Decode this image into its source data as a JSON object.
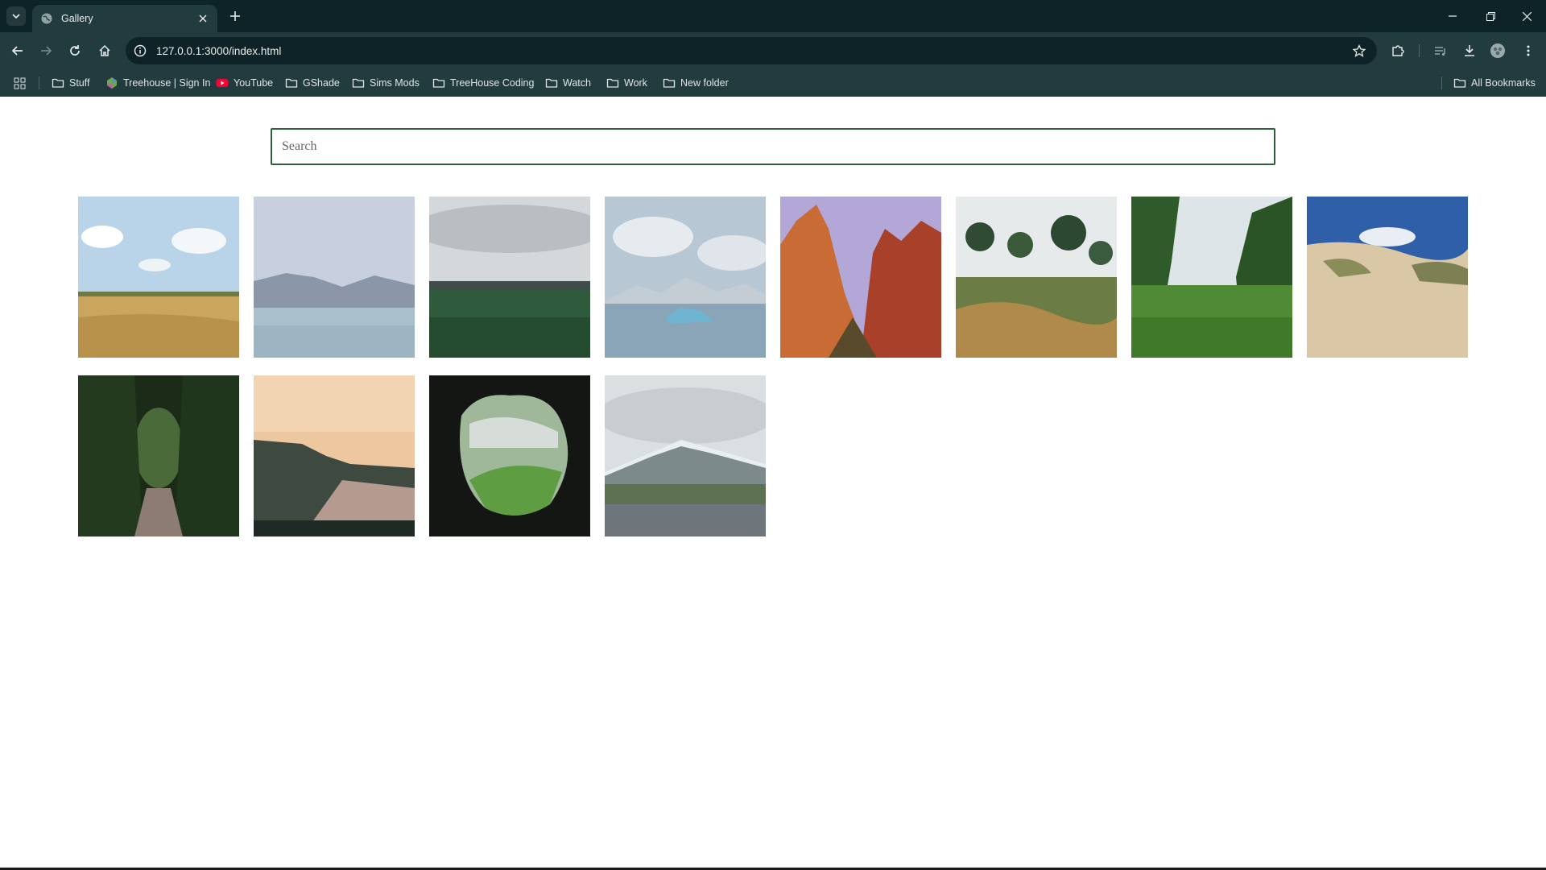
{
  "browser": {
    "tab_title": "Gallery",
    "url": "127.0.0.1:3000/index.html",
    "bookmarks": [
      {
        "label": "Stuff",
        "icon": "folder-icon"
      },
      {
        "label": "Treehouse | Sign In",
        "icon": "treehouse-favicon"
      },
      {
        "label": "YouTube",
        "icon": "youtube-favicon"
      },
      {
        "label": "GShade",
        "icon": "folder-icon"
      },
      {
        "label": "Sims Mods",
        "icon": "folder-icon"
      },
      {
        "label": "TreeHouse Coding",
        "icon": "folder-icon"
      },
      {
        "label": "Watch",
        "icon": "folder-icon"
      },
      {
        "label": "Work",
        "icon": "folder-icon"
      },
      {
        "label": "New folder",
        "icon": "folder-icon"
      }
    ],
    "all_bookmarks": "All Bookmarks"
  },
  "search": {
    "placeholder": "Search",
    "value": ""
  },
  "gallery": {
    "photos": [
      {
        "subject": "golden hay field under cloudy sky"
      },
      {
        "subject": "pastel lake with mountains"
      },
      {
        "subject": "green field under overcast sky"
      },
      {
        "subject": "icebergs in glacier lagoon"
      },
      {
        "subject": "red rock canyon cliffs"
      },
      {
        "subject": "garden with tall pines"
      },
      {
        "subject": "lush green stream"
      },
      {
        "subject": "sand dunes with grass"
      },
      {
        "subject": "forest path tunnel of trees"
      },
      {
        "subject": "sunset coastal cliffs"
      },
      {
        "subject": "valley seen through a cave opening"
      },
      {
        "subject": "snowy mountain over lupine meadow"
      }
    ]
  },
  "colors": {
    "chrome_dark": "#0e2327",
    "chrome": "#213b3f",
    "search_border": "#2f5f3a"
  }
}
